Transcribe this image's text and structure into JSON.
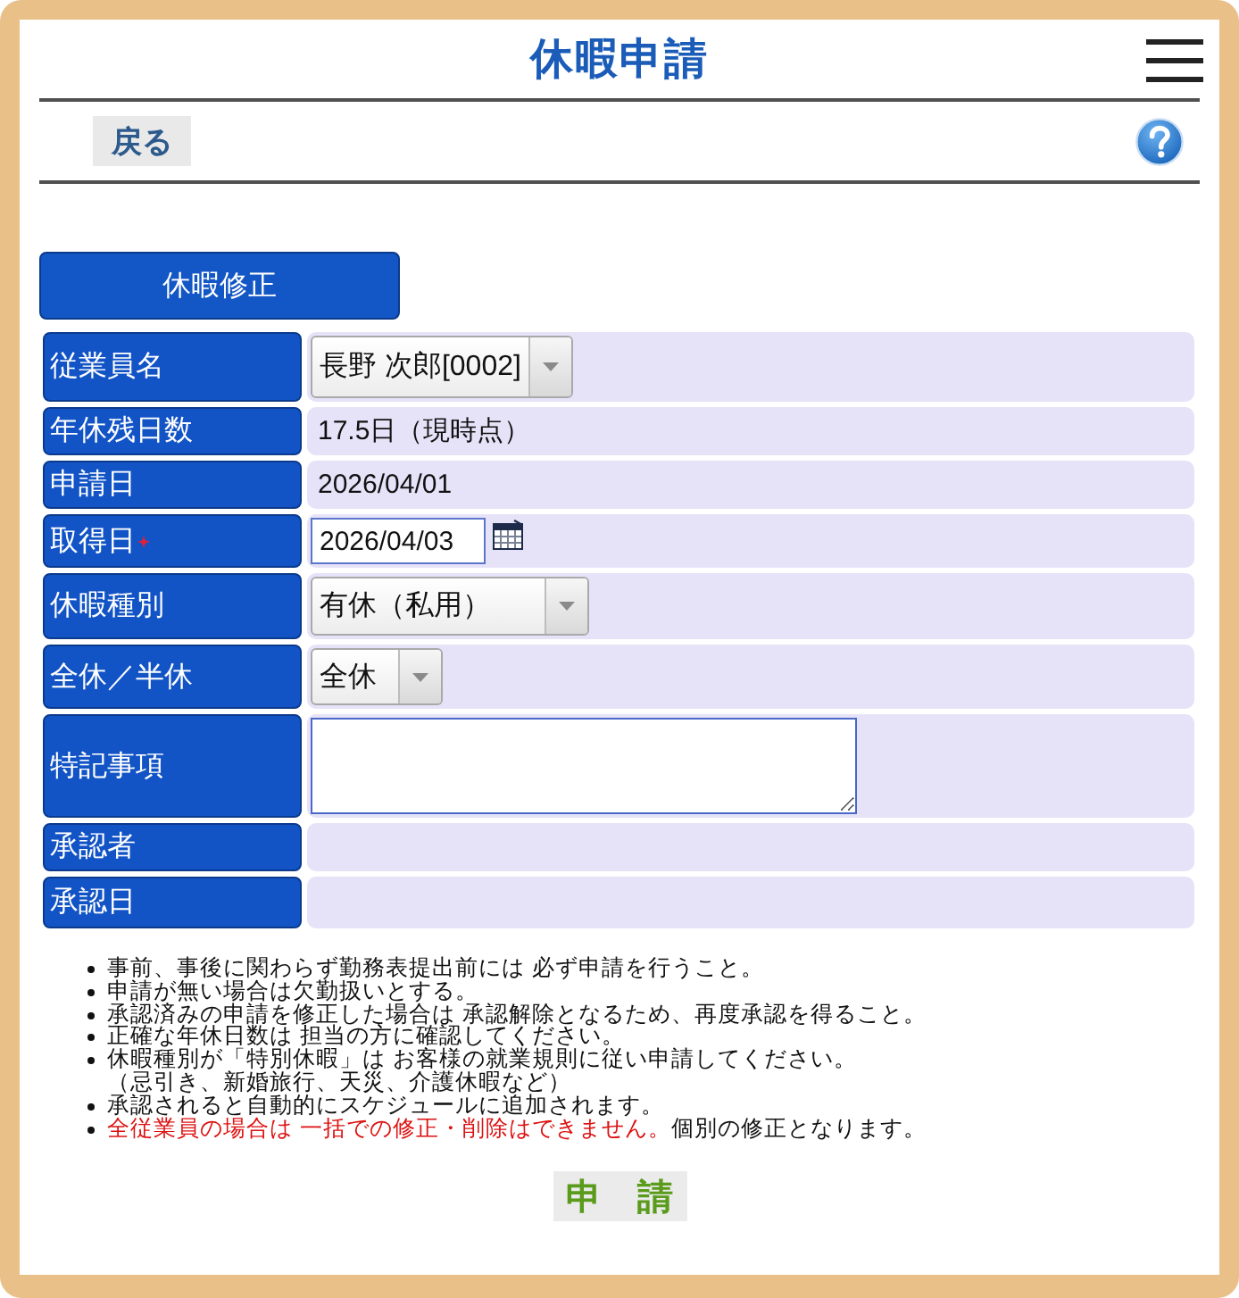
{
  "header": {
    "title": "休暇申請"
  },
  "toolbar": {
    "back_button": "戻る"
  },
  "mode_button": "休暇修正",
  "fields": [
    {
      "label": "従業員名",
      "kind": "select",
      "value": "長野 次郎[0002]",
      "required": false
    },
    {
      "label": "年休残日数",
      "kind": "text",
      "value": "17.5日（現時点）",
      "required": false
    },
    {
      "label": "申請日",
      "kind": "text",
      "value": "2026/04/01",
      "required": false
    },
    {
      "label": "取得日",
      "kind": "date",
      "value": "2026/04/03",
      "required": true
    },
    {
      "label": "休暇種別",
      "kind": "select",
      "value": "有休（私用）",
      "required": false
    },
    {
      "label": "全休／半休",
      "kind": "select",
      "value": "全休",
      "required": false
    },
    {
      "label": "特記事項",
      "kind": "textarea",
      "required": false
    },
    {
      "label": "承認者",
      "kind": "empty",
      "required": false
    },
    {
      "label": "承認日",
      "kind": "empty",
      "required": false
    }
  ],
  "notes": [
    {
      "kind": "plain",
      "lines": [
        "事前、事後に関わらず勤務表提出前には 必ず申請を行うこと。"
      ]
    },
    {
      "kind": "plain",
      "lines": [
        "申請が無い場合は欠勤扱いとする。"
      ]
    },
    {
      "kind": "plain",
      "lines": [
        "承認済みの申請を修正した場合は 承認解除となるため、再度承認を得ること。"
      ]
    },
    {
      "kind": "plain",
      "lines": [
        "正確な年休日数は 担当の方に確認してください。"
      ]
    },
    {
      "kind": "plain",
      "lines": [
        "休暇種別が「特別休暇」は お客様の就業規則に従い申請してください。",
        "（忌引き、新婚旅行、天災、介護休暇など）"
      ]
    },
    {
      "kind": "plain",
      "lines": [
        "承認されると自動的にスケジュールに追加されます。"
      ]
    },
    {
      "kind": "warning",
      "warning": "全従業員の場合は 一括での修正・削除はできません。",
      "lines": [
        "個別の修正となります。"
      ]
    }
  ],
  "submit_button": "申　請"
}
